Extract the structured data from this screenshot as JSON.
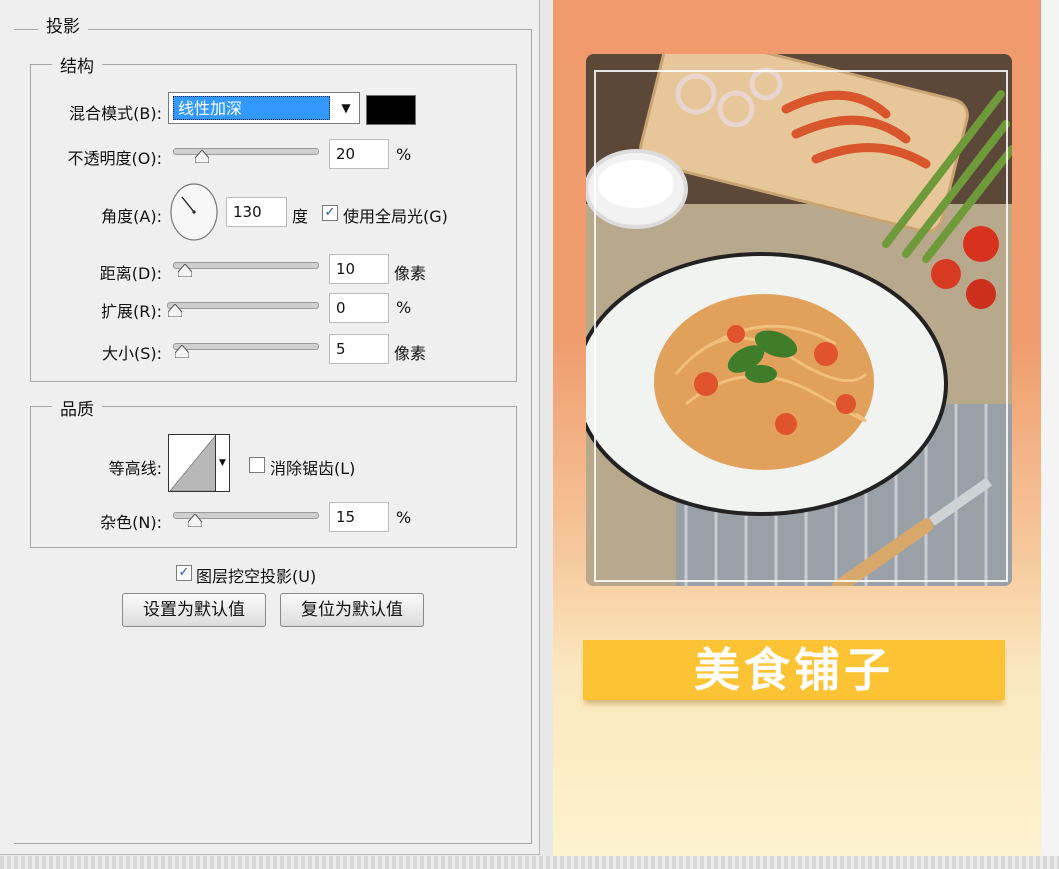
{
  "dialog": {
    "section_title": "投影",
    "structure": {
      "title": "结构",
      "blend_mode_label": "混合模式(B):",
      "blend_mode_value": "线性加深",
      "shadow_color": "#000000",
      "opacity_label": "不透明度(O):",
      "opacity_value": "20",
      "opacity_fraction": 0.2,
      "opacity_unit": "%",
      "angle_label": "角度(A):",
      "angle_value": "130",
      "angle_unit": "度",
      "global_light_label": "使用全局光(G)",
      "global_light_checked": true,
      "distance_label": "距离(D):",
      "distance_value": "10",
      "distance_unit": "像素",
      "spread_label": "扩展(R):",
      "spread_value": "0",
      "spread_unit": "%",
      "size_label": "大小(S):",
      "size_value": "5",
      "size_unit": "像素"
    },
    "quality": {
      "title": "品质",
      "contour_label": "等高线:",
      "anti_alias_label": "消除锯齿(L)",
      "anti_alias_checked": false,
      "noise_label": "杂色(N):",
      "noise_value": "15",
      "noise_unit": "%"
    },
    "knockout_label": "图层挖空投影(U)",
    "knockout_checked": true,
    "set_default_label": "设置为默认值",
    "reset_default_label": "复位为默认值"
  },
  "preview": {
    "banner_text": "美食铺子",
    "banner_color": "#fcc335"
  }
}
